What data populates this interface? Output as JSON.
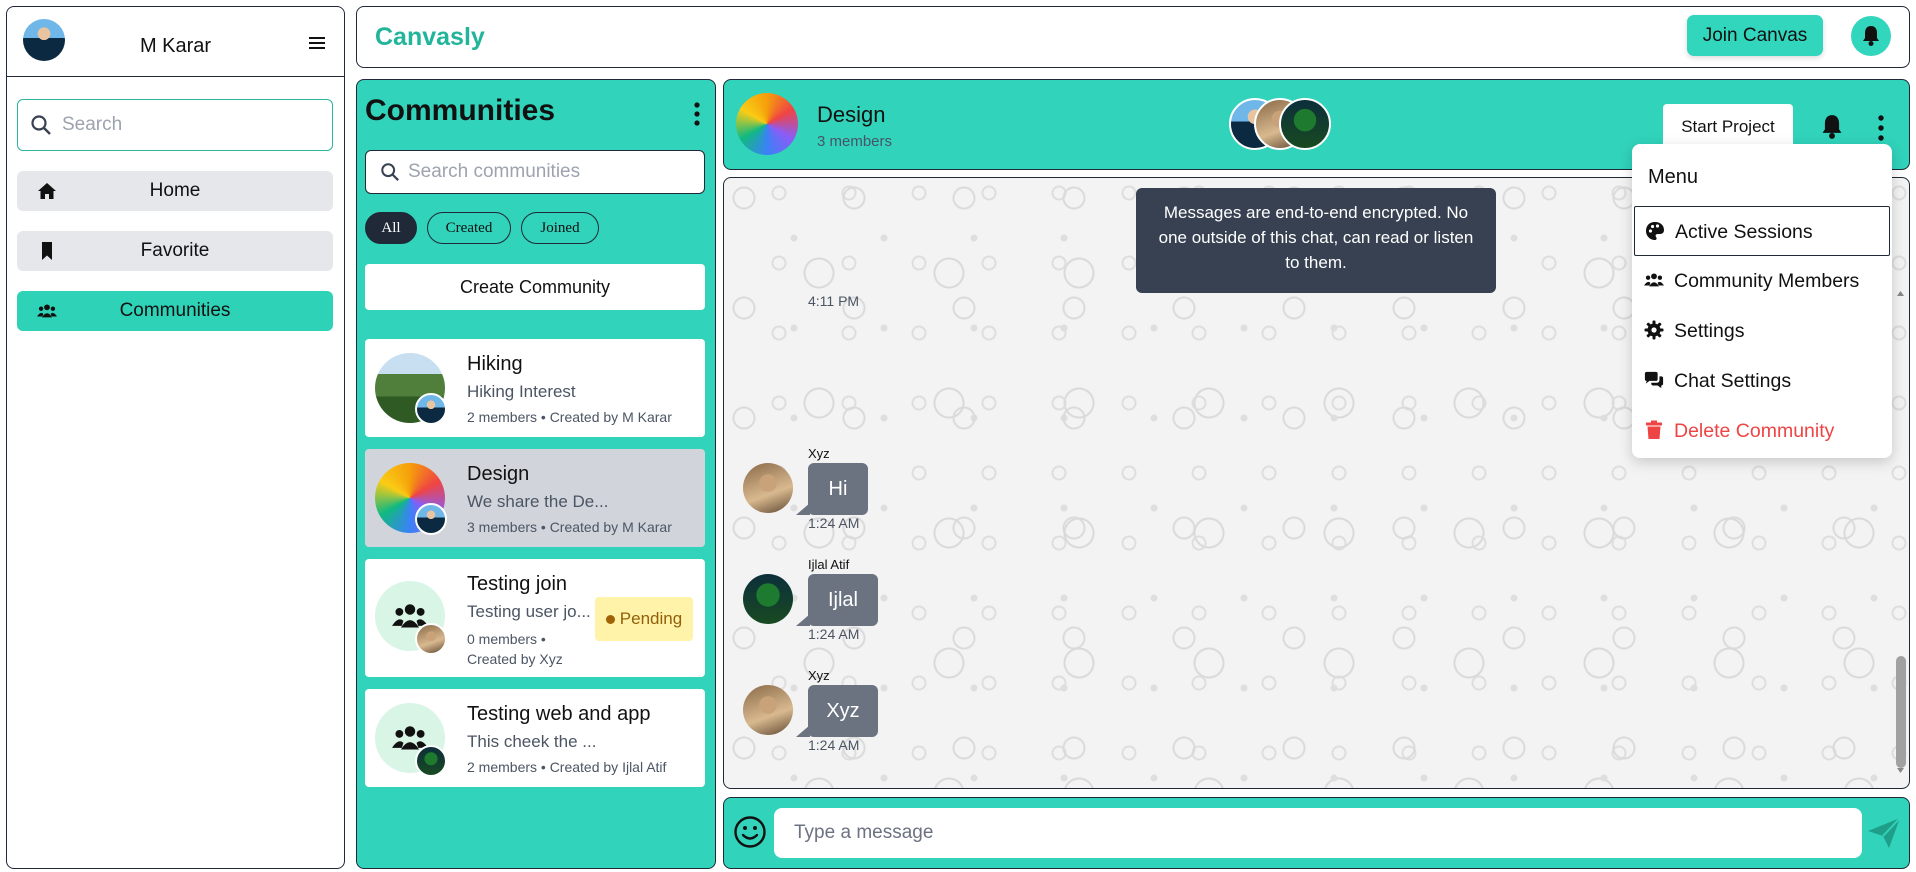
{
  "sidebar": {
    "user_name": "M Karar",
    "search_placeholder": "Search",
    "nav": [
      {
        "label": "Home",
        "icon": "home-icon"
      },
      {
        "label": "Favorite",
        "icon": "bookmark-icon"
      },
      {
        "label": "Communities",
        "icon": "users-icon",
        "active": true
      }
    ]
  },
  "topbar": {
    "brand": "Canvasly",
    "join_button": "Join Canvas",
    "bell_icon": "bell-icon"
  },
  "communities": {
    "title": "Communities",
    "search_placeholder": "Search communities",
    "filters": [
      "All",
      "Created",
      "Joined"
    ],
    "active_filter": "All",
    "create_button": "Create Community",
    "cards": [
      {
        "name": "Hiking",
        "description": "Hiking Interest",
        "meta": "2 members • Created by M Karar",
        "selected": false
      },
      {
        "name": "Design",
        "description": "We share the De...",
        "meta": "3 members • Created by M Karar",
        "selected": true
      },
      {
        "name": "Testing join",
        "description": "Testing user jo...",
        "meta_line1": "0 members •",
        "meta_line2": "Created by Xyz",
        "status": "Pending"
      },
      {
        "name": "Testing web and app",
        "description": "This cheek the ...",
        "meta": "2 members • Created by Ijlal Atif"
      }
    ]
  },
  "chat": {
    "name": "Design",
    "members": "3 members",
    "start_button": "Start Project",
    "encryption_notice": "Messages are end-to-end encrypted. No one outside of this chat, can read or listen to them.",
    "first_time": "4:11 PM",
    "messages": [
      {
        "sender": "Xyz",
        "text": "Hi",
        "time": "1:24 AM"
      },
      {
        "sender": "Ijlal Atif",
        "text": "Ijlal",
        "time": "1:24 AM"
      },
      {
        "sender": "Xyz",
        "text": "Xyz",
        "time": "1:24 AM"
      }
    ],
    "input_placeholder": "Type a message"
  },
  "menu": {
    "title": "Menu",
    "items": [
      {
        "label": "Active Sessions",
        "icon": "palette-icon"
      },
      {
        "label": "Community Members",
        "icon": "users-icon"
      },
      {
        "label": "Settings",
        "icon": "gear-icon"
      },
      {
        "label": "Chat Settings",
        "icon": "chat-icon"
      },
      {
        "label": "Delete Community",
        "icon": "trash-icon",
        "danger": true
      }
    ]
  },
  "colors": {
    "accent": "#31d3bb",
    "brand_text": "#22b59c",
    "notice_bg": "#374151",
    "bubble_bg": "#6b7280",
    "danger": "#ef4444",
    "pending_bg": "#fef3a8"
  }
}
